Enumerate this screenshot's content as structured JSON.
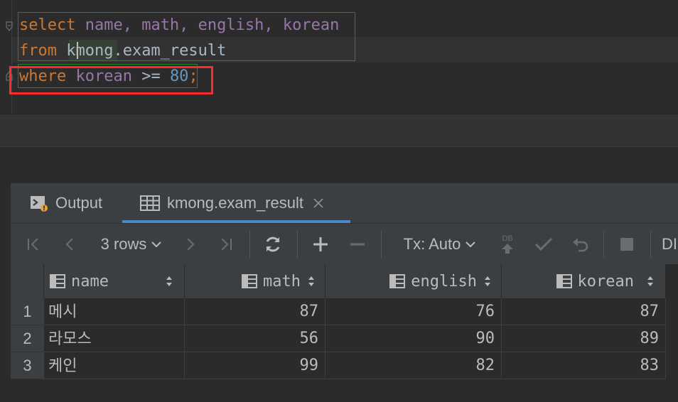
{
  "editor": {
    "line1": {
      "kw": "select",
      "cols": " name, math, english, korean"
    },
    "line2": {
      "kw": "from",
      "rest": " kmong.exam_result"
    },
    "line3": {
      "kw": "where",
      "col": " korean",
      "op": " >= ",
      "num": "80",
      "semi": ";"
    }
  },
  "tabs": [
    {
      "label": "Output",
      "icon": "console-icon"
    },
    {
      "label": "kmong.exam_result",
      "icon": "table-icon",
      "active": true
    }
  ],
  "toolbar": {
    "rows_label": "3 rows",
    "tx_label": "Tx: Auto",
    "db_label": "DB",
    "cut_label": "DI"
  },
  "grid": {
    "columns": [
      "name",
      "math",
      "english",
      "korean"
    ],
    "rows": [
      {
        "n": "1",
        "name": "메시",
        "math": "87",
        "english": "76",
        "korean": "87"
      },
      {
        "n": "2",
        "name": "라모스",
        "math": "56",
        "english": "90",
        "korean": "89"
      },
      {
        "n": "3",
        "name": "케인",
        "math": "99",
        "english": "82",
        "korean": "83"
      }
    ]
  },
  "colors": {
    "keyword": "#cc7832",
    "column": "#9876aa",
    "number": "#6897bb",
    "highlight": "#ff2a2a",
    "accent": "#4a88c7"
  }
}
